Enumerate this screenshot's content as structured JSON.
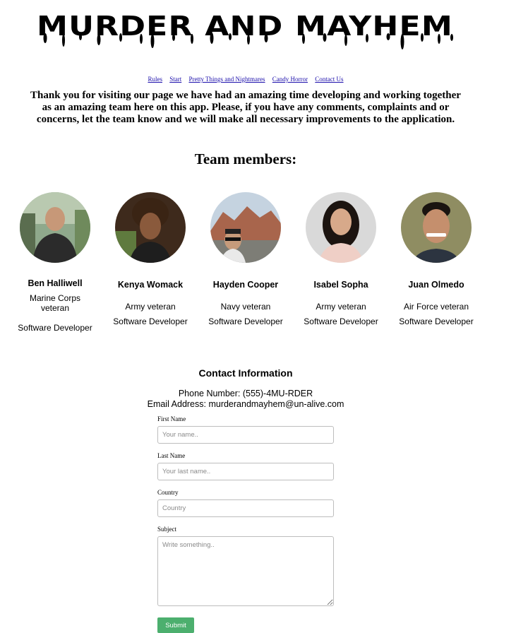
{
  "site": {
    "title": "MURDER AND MAYHEM"
  },
  "nav": {
    "items": [
      {
        "label": "Rules"
      },
      {
        "label": "Start"
      },
      {
        "label": "Pretty Things and Nightmares"
      },
      {
        "label": "Candy Horror"
      },
      {
        "label": "Contact Us"
      }
    ]
  },
  "intro": {
    "text": "Thank you for visiting our page we have had an amazing time developing and working together as an amazing team here on this app. Please, if you have any comments, complaints and or concerns, let the team know and we will make all necessary improvements to the application."
  },
  "team": {
    "heading": "Team members:",
    "members": [
      {
        "name": "Ben Halliwell",
        "branch": "Marine Corps veteran",
        "role": "Software Developer"
      },
      {
        "name": "Kenya Womack",
        "branch": "Army veteran",
        "role": "Software Developer"
      },
      {
        "name": "Hayden Cooper",
        "branch": "Navy veteran",
        "role": "Software Developer"
      },
      {
        "name": "Isabel Sopha",
        "branch": "Army veteran",
        "role": "Software Developer"
      },
      {
        "name": "Juan Olmedo",
        "branch": "Air Force veteran",
        "role": "Software Developer"
      }
    ]
  },
  "contact": {
    "heading": "Contact Information",
    "phone": "Phone Number: (555)-4MU-RDER",
    "email": "Email Address: murderandmayhem@un-alive.com"
  },
  "form": {
    "first_name_label": "First Name",
    "first_name_placeholder": "Your name..",
    "first_name_value": "",
    "last_name_label": "Last Name",
    "last_name_placeholder": "Your last name..",
    "last_name_value": "",
    "country_label": "Country",
    "country_placeholder": "Country",
    "country_value": "",
    "subject_label": "Subject",
    "subject_placeholder": "Write something..",
    "subject_value": "",
    "submit_label": "Submit"
  },
  "colors": {
    "submit_bg": "#4caf6e",
    "link": "#1a0dab"
  }
}
